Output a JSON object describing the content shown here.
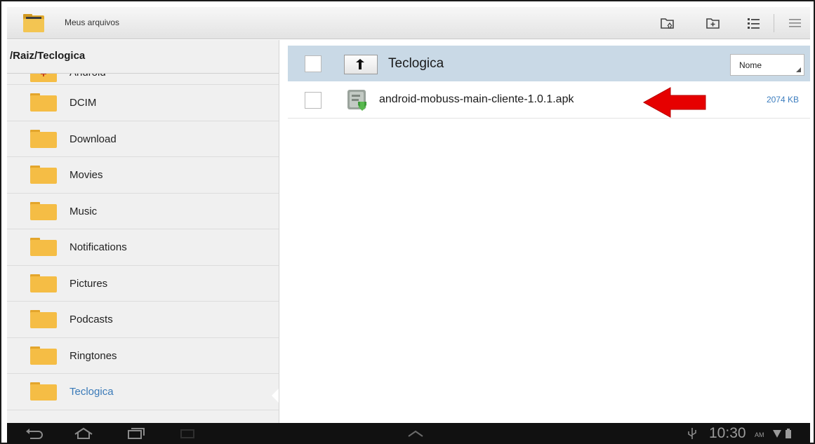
{
  "topbar": {
    "title": "Meus arquivos",
    "actions": [
      "home-folder-icon",
      "new-folder-icon",
      "list-view-icon",
      "menu-icon"
    ]
  },
  "sidebar": {
    "path": "/Raiz/Teclogica",
    "folders": [
      {
        "label": "Android",
        "icon": "folder-plus-icon"
      },
      {
        "label": "DCIM",
        "icon": "folder-icon"
      },
      {
        "label": "Download",
        "icon": "folder-icon"
      },
      {
        "label": "Movies",
        "icon": "folder-icon"
      },
      {
        "label": "Music",
        "icon": "folder-icon"
      },
      {
        "label": "Notifications",
        "icon": "folder-icon"
      },
      {
        "label": "Pictures",
        "icon": "folder-icon"
      },
      {
        "label": "Podcasts",
        "icon": "folder-icon"
      },
      {
        "label": "Ringtones",
        "icon": "folder-icon"
      },
      {
        "label": "Teclogica",
        "icon": "folder-icon",
        "selected": true
      }
    ]
  },
  "main": {
    "directory": "Teclogica",
    "sort_label": "Nome",
    "files": [
      {
        "name": "android-mobuss-main-cliente-1.0.1.apk",
        "size": "2074 KB",
        "icon": "apk-file-icon"
      }
    ]
  },
  "systembar": {
    "time": "10:30",
    "ampm": "AM"
  },
  "colors": {
    "header_bg": "#c9d9e6",
    "selected_text": "#3a7ab8",
    "size_text": "#3d7ebf",
    "arrow": "#e60000",
    "folder": "#f3b73a"
  }
}
